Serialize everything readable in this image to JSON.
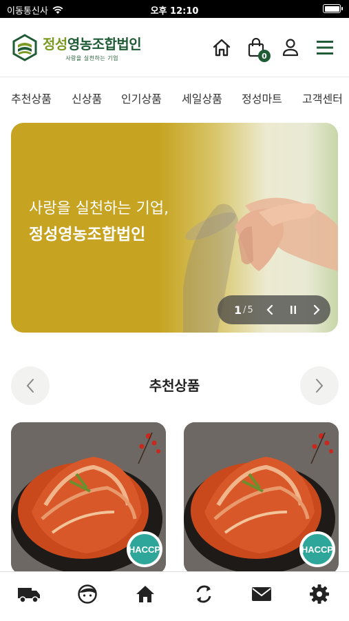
{
  "status_bar": {
    "carrier": "이동통신사",
    "time": "오후 12:10"
  },
  "header": {
    "logo": {
      "name_part1": "정성",
      "name_part2": "영농조합법인",
      "slogan": "사랑을 실천하는 기업"
    },
    "cart_count": "0"
  },
  "nav": {
    "items": [
      {
        "label": "추천상품"
      },
      {
        "label": "신상품"
      },
      {
        "label": "인기상품"
      },
      {
        "label": "세일상품"
      },
      {
        "label": "정성마트"
      },
      {
        "label": "고객센터"
      }
    ]
  },
  "banner": {
    "line1": "사랑을 실천하는 기업,",
    "line2": "정성영농조합법인",
    "current": "1",
    "separator": "/",
    "total": "5"
  },
  "section": {
    "title": "추천상품"
  },
  "products": [
    {
      "badge_text": "HACCP"
    },
    {
      "badge_text": "HACCP"
    }
  ],
  "colors": {
    "brand_green": "#1f5c36",
    "brand_olive": "#7a9a24",
    "banner_gold": "#c6a320"
  },
  "icons": {
    "header": [
      "home-icon",
      "cart-icon",
      "user-icon",
      "menu-icon"
    ],
    "bottom": [
      "truck-icon",
      "face-icon",
      "home-icon",
      "refresh-icon",
      "mail-icon",
      "gear-icon"
    ]
  }
}
